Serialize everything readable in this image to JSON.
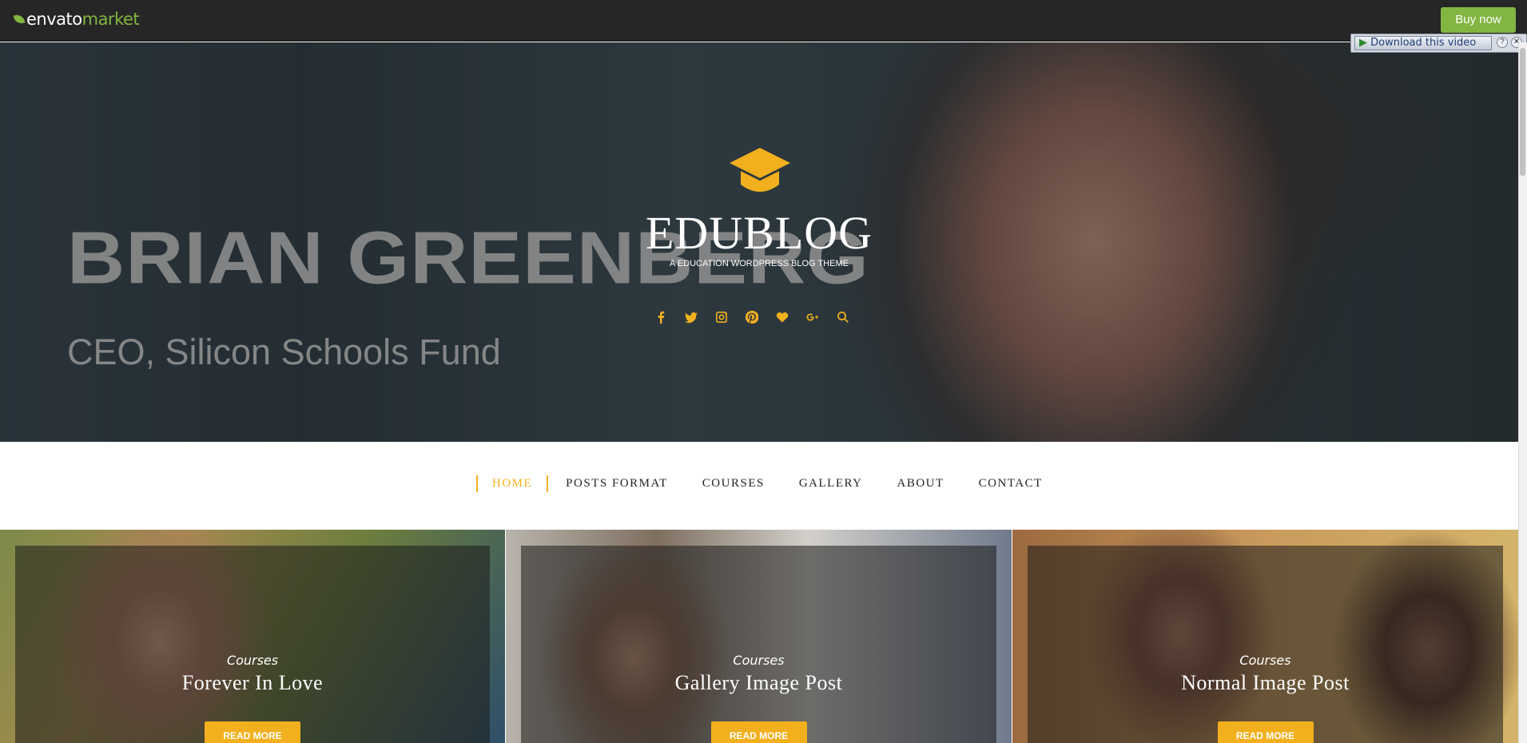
{
  "topbar": {
    "brand_envato": "envato",
    "brand_market": "market",
    "buy_label": "Buy now"
  },
  "download_bar": {
    "label": "Download this video",
    "help": "?",
    "close": "✕"
  },
  "hero": {
    "video_name": "BRIAN GREENBERG",
    "video_role": "CEO, Silicon Schools Fund",
    "site_title": "EDUBLOG",
    "site_tagline": "A EDUCATION WORDPRESS BLOG THEME",
    "social_icons": [
      "facebook-icon",
      "twitter-icon",
      "instagram-icon",
      "pinterest-icon",
      "heart-icon",
      "google-plus-icon",
      "search-icon"
    ]
  },
  "nav": {
    "items": [
      {
        "label": "HOME"
      },
      {
        "label": "POSTS FORMAT"
      },
      {
        "label": "COURSES"
      },
      {
        "label": "GALLERY"
      },
      {
        "label": "ABOUT"
      },
      {
        "label": "CONTACT"
      }
    ]
  },
  "cards": [
    {
      "category": "Courses",
      "title": "Forever In Love",
      "button": "READ MORE"
    },
    {
      "category": "Courses",
      "title": "Gallery Image Post",
      "button": "READ MORE"
    },
    {
      "category": "Courses",
      "title": "Normal Image Post",
      "button": "READ MORE"
    }
  ],
  "colors": {
    "accent": "#f2b01e",
    "envato_green": "#82b541",
    "topbar_bg": "#262626"
  }
}
